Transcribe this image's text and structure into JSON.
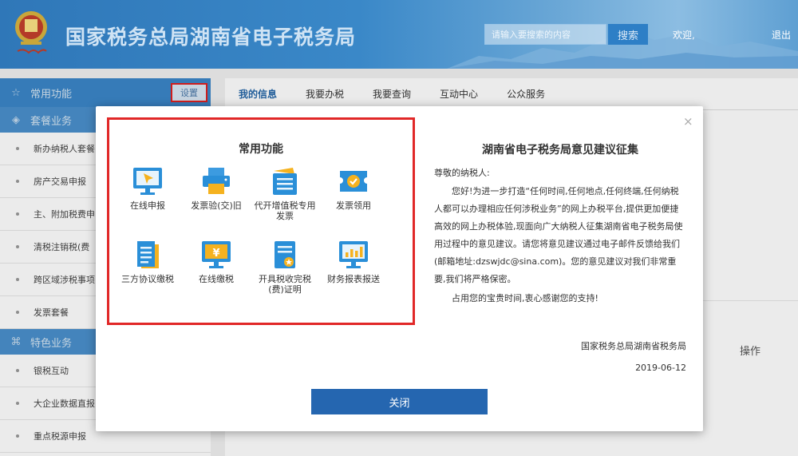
{
  "header": {
    "title": "国家税务总局湖南省电子税务局",
    "search_placeholder": "请输入要搜索的内容",
    "search_label": "搜索",
    "welcome": "欢迎,",
    "logout": "退出"
  },
  "sidebar": {
    "common_label": "常用功能",
    "settings_label": "设置",
    "package_label": "套餐业务",
    "package_items": [
      "新办纳税人套餐",
      "房产交易申报",
      "主、附加税费申",
      "清税注销税(费",
      "跨区域涉税事项",
      "发票套餐"
    ],
    "special_label": "特色业务",
    "special_items": [
      "银税互动",
      "大企业数据直报",
      "重点税源申报"
    ]
  },
  "main": {
    "tabs": [
      "我的信息",
      "我要办税",
      "我要查询",
      "互动中心",
      "公众服务"
    ],
    "ops_label": "操作"
  },
  "modal": {
    "close_symbol": "×",
    "func_title": "常用功能",
    "functions": [
      {
        "label": "在线申报",
        "icon": "monitor-cursor-icon"
      },
      {
        "label": "发票验(交)旧",
        "icon": "printer-icon"
      },
      {
        "label": "代开增值税专用发票",
        "icon": "invoice-folder-icon"
      },
      {
        "label": "发票领用",
        "icon": "ticket-check-icon"
      },
      {
        "label": "三方协议缴税",
        "icon": "document-list-icon"
      },
      {
        "label": "在线缴税",
        "icon": "monitor-yen-icon"
      },
      {
        "label": "开具税收完税(费)证明",
        "icon": "certificate-icon"
      },
      {
        "label": "财务报表报送",
        "icon": "bar-chart-monitor-icon"
      }
    ],
    "notice_title": "湖南省电子税务局意见建议征集",
    "notice_greeting": "尊敬的纳税人:",
    "notice_body": "您好!为进一步打造“任何时间,任何地点,任何终端,任何纳税人都可以办理相应任何涉税业务”的网上办税平台,提供更加便捷高效的网上办税体验,现面向广大纳税人征集湖南省电子税务局使用过程中的意见建议。请您将意见建议通过电子邮件反馈给我们(邮箱地址:dzswjdc@sina.com)。您的意见建议对我们非常重要,我们将严格保密。",
    "notice_thanks": "占用您的宝贵时间,衷心感谢您的支持!",
    "notice_org": "国家税务总局湖南省税务局",
    "notice_date": "2019-06-12",
    "close_button": "关闭"
  },
  "colors": {
    "header_blue": "#3a88c8",
    "accent_blue": "#2566b0",
    "highlight_red": "#e12828"
  }
}
